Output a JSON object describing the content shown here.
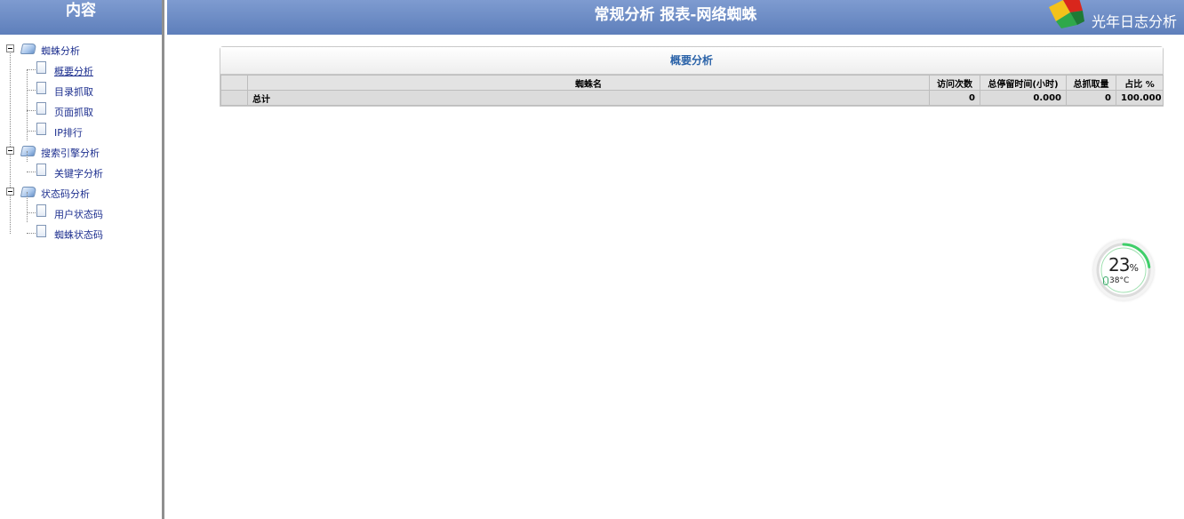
{
  "left_panel": {
    "header": "内容",
    "tree": [
      {
        "label": "蜘蛛分析",
        "children": [
          "概要分析",
          "目录抓取",
          "页面抓取",
          "IP排行"
        ]
      },
      {
        "label": "搜索引擎分析",
        "children": [
          "关键字分析"
        ]
      },
      {
        "label": "状态码分析",
        "children": [
          "用户状态码",
          "蜘蛛状态码"
        ]
      }
    ]
  },
  "header": {
    "title": "常规分析 报表-网络蜘蛛",
    "brand": "光年日志分析"
  },
  "report": {
    "title": "概要分析",
    "columns": [
      "",
      "蜘蛛名",
      "访问次数",
      "总停留时间(小时)",
      "总抓取量",
      "占比 %"
    ],
    "rows": [
      [
        "",
        "总计",
        "0",
        "0.000",
        "0",
        "100.000"
      ]
    ]
  },
  "widget": {
    "percent": "23",
    "percent_unit": "%",
    "temperature": "38°C",
    "progress_fraction": 0.23,
    "ring_color": "#3fcf6a"
  },
  "colors": {
    "header_top": "#7e9bd0",
    "header_bottom": "#5e7fbb",
    "link": "#1d2f8f",
    "report_title": "#2a62a8"
  }
}
